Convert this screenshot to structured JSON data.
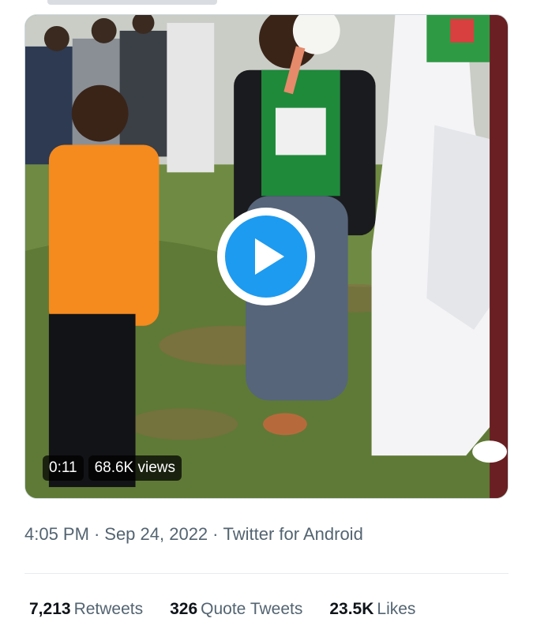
{
  "video": {
    "duration": "0:11",
    "views": "68.6K views"
  },
  "tweet_meta": {
    "time": "4:05 PM",
    "date": "Sep 24, 2022",
    "source": "Twitter for Android",
    "separator": "·"
  },
  "stats": {
    "retweets_count": "7,213",
    "retweets_label": "Retweets",
    "quote_count": "326",
    "quote_label": "Quote Tweets",
    "likes_count": "23.5K",
    "likes_label": "Likes"
  },
  "colors": {
    "accent": "#1d9bf0",
    "secondary_text": "#536471",
    "primary_text": "#0f1419"
  },
  "icons": {
    "play": "play-icon"
  }
}
